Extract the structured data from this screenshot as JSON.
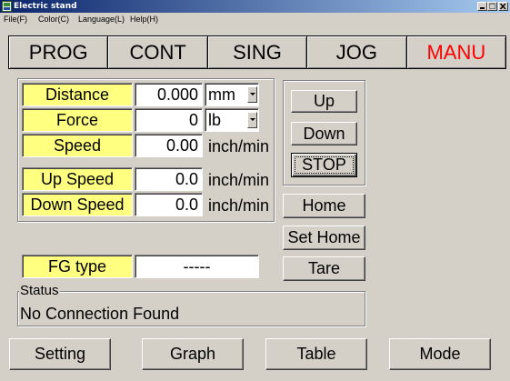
{
  "window": {
    "title": "Electric stand",
    "icon": "app-icon",
    "controls": {
      "minimize": "minimize-icon",
      "maximize": "maximize-icon",
      "close": "close-icon"
    }
  },
  "menu": {
    "items": [
      {
        "label": "File(F)"
      },
      {
        "label": "Color(C)"
      },
      {
        "label": "Language(L)"
      },
      {
        "label": "Help(H)"
      }
    ]
  },
  "mode_tabs": {
    "items": [
      {
        "label": "PROG",
        "active": false
      },
      {
        "label": "CONT",
        "active": false
      },
      {
        "label": "SING",
        "active": false
      },
      {
        "label": "JOG",
        "active": false
      },
      {
        "label": "MANU",
        "active": true
      }
    ]
  },
  "readings": {
    "distance": {
      "label": "Distance",
      "value": "0.000",
      "unit": "mm"
    },
    "force": {
      "label": "Force",
      "value": "0",
      "unit": "lb"
    },
    "speed": {
      "label": "Speed",
      "value": "0.00",
      "unit": "inch/min"
    },
    "up_speed": {
      "label": "Up Speed",
      "value": "0.0",
      "unit": "inch/min"
    },
    "down_speed": {
      "label": "Down Speed",
      "value": "0.0",
      "unit": "inch/min"
    }
  },
  "motion": {
    "up": "Up",
    "down": "Down",
    "stop": "STOP"
  },
  "position": {
    "home": "Home",
    "set_home": "Set Home",
    "tare": "Tare"
  },
  "fg_type": {
    "label": "FG type",
    "value": "-----"
  },
  "status": {
    "caption": "Status",
    "message": "No Connection Found"
  },
  "footer": {
    "items": [
      {
        "label": "Setting"
      },
      {
        "label": "Graph"
      },
      {
        "label": "Table"
      },
      {
        "label": "Mode"
      }
    ]
  },
  "colors": {
    "window_bg": "#D4D0C8",
    "title_start": "#0A246A",
    "title_end": "#A6CAF0",
    "label_bg": "#FFFF80",
    "field_bg": "#FFFFFF",
    "active_tab_text": "#FF0000"
  }
}
